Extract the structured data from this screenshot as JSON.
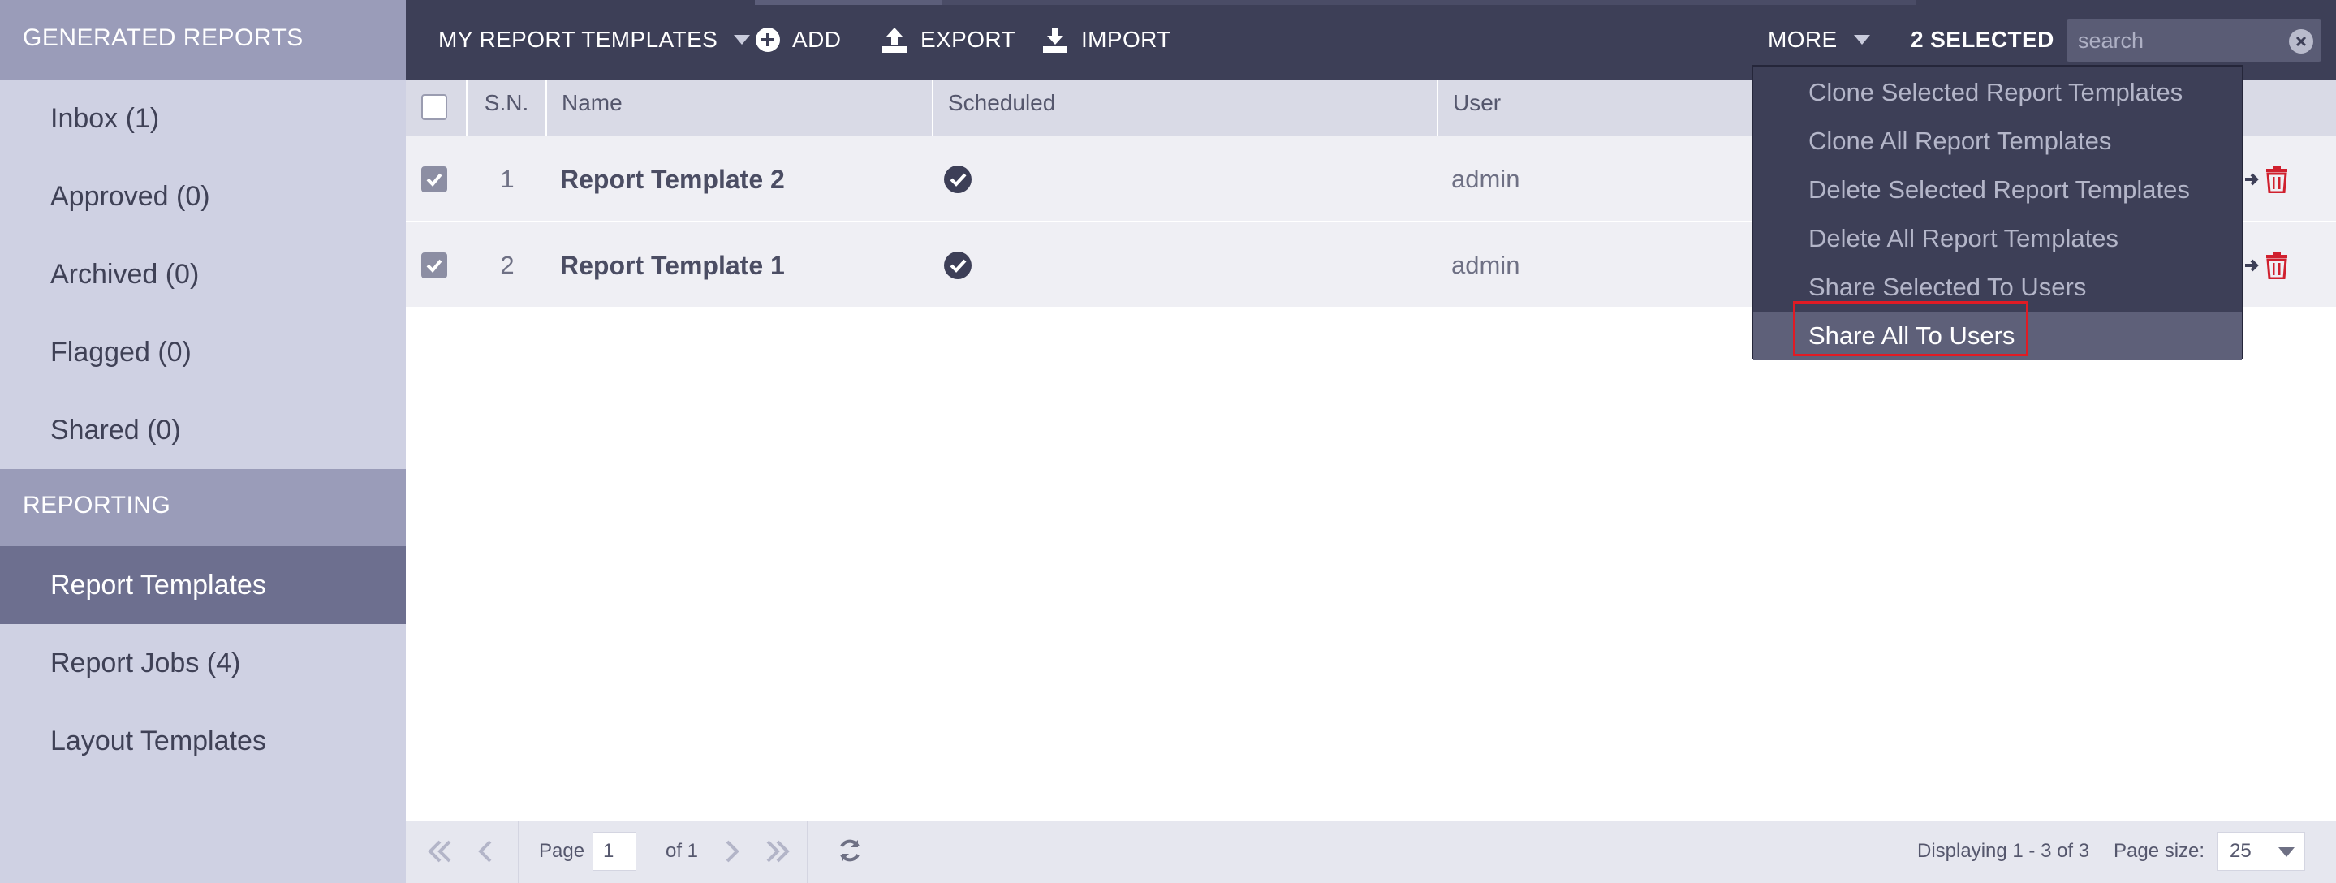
{
  "sidebar": {
    "sections": [
      {
        "title": "Generated Reports",
        "items": [
          "Inbox (1)",
          "Approved (0)",
          "Archived (0)",
          "Flagged (0)",
          "Shared (0)"
        ]
      },
      {
        "title": "Reporting",
        "items": [
          "Report Templates",
          "Report Jobs (4)",
          "Layout Templates"
        ]
      }
    ]
  },
  "toolbar": {
    "templates_label": "My Report Templates",
    "add_label": "Add",
    "export_label": "Export",
    "import_label": "Import",
    "more_label": "More",
    "selected_label": "2 Selected",
    "search_placeholder": "search"
  },
  "grid": {
    "columns": [
      "S.N.",
      "Name",
      "Scheduled",
      "User"
    ],
    "rows": [
      {
        "sn": "1",
        "name": "Report Template 2",
        "user": "admin",
        "checked": true,
        "scheduled": true
      },
      {
        "sn": "2",
        "name": "Report Template 1",
        "user": "admin",
        "checked": true,
        "scheduled": true
      }
    ]
  },
  "more_menu": {
    "items": [
      "Clone Selected Report Templates",
      "Clone All Report Templates",
      "Delete Selected Report Templates",
      "Delete All Report Templates",
      "Share Selected To Users",
      "Share All To Users"
    ],
    "active_index": 5
  },
  "pager": {
    "page_label": "Page",
    "page_value": "1",
    "of_label": "of 1",
    "displaying": "Displaying 1 - 3 of 3",
    "page_size_label": "Page size:",
    "page_size_value": "25"
  },
  "colors": {
    "toolbar_bg": "#3d3f57",
    "sidebar_bg": "#cfd1e3",
    "sidebar_header_bg": "#9a9cb9",
    "active_item_bg": "#6d6f8f",
    "delete_icon": "#d0202e",
    "highlight_border": "#e01b24"
  }
}
